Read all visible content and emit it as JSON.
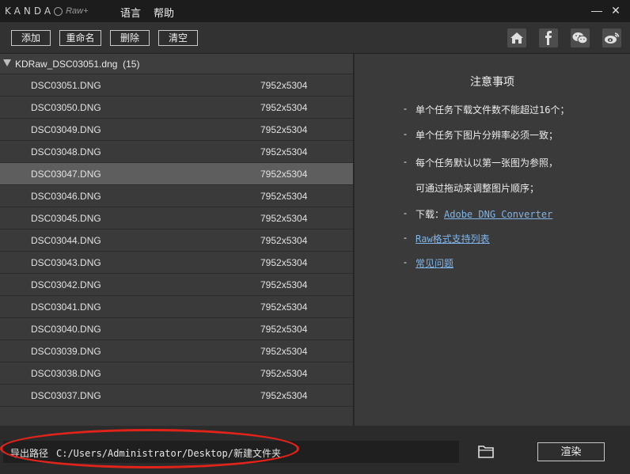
{
  "titlebar": {
    "brand": "KANDA",
    "raw": "Raw+",
    "menu_language": "语言",
    "menu_help": "帮助",
    "minimize": "—",
    "close": "✕"
  },
  "toolbar": {
    "add": "添加",
    "rename": "重命名",
    "delete": "删除",
    "clear": "清空",
    "social_icons": [
      "home-icon",
      "facebook-icon",
      "wechat-icon",
      "weibo-icon"
    ]
  },
  "filelist": {
    "group_name": "KDRaw_DSC03051.dng",
    "group_count": "(15)",
    "files": [
      {
        "name": "DSC03051.DNG",
        "res": "7952x5304"
      },
      {
        "name": "DSC03050.DNG",
        "res": "7952x5304"
      },
      {
        "name": "DSC03049.DNG",
        "res": "7952x5304"
      },
      {
        "name": "DSC03048.DNG",
        "res": "7952x5304"
      },
      {
        "name": "DSC03047.DNG",
        "res": "7952x5304"
      },
      {
        "name": "DSC03046.DNG",
        "res": "7952x5304"
      },
      {
        "name": "DSC03045.DNG",
        "res": "7952x5304"
      },
      {
        "name": "DSC03044.DNG",
        "res": "7952x5304"
      },
      {
        "name": "DSC03043.DNG",
        "res": "7952x5304"
      },
      {
        "name": "DSC03042.DNG",
        "res": "7952x5304"
      },
      {
        "name": "DSC03041.DNG",
        "res": "7952x5304"
      },
      {
        "name": "DSC03040.DNG",
        "res": "7952x5304"
      },
      {
        "name": "DSC03039.DNG",
        "res": "7952x5304"
      },
      {
        "name": "DSC03038.DNG",
        "res": "7952x5304"
      },
      {
        "name": "DSC03037.DNG",
        "res": "7952x5304"
      }
    ],
    "selected_index": 4
  },
  "notes": {
    "title": "注意事项",
    "dash": "-",
    "line1": "单个任务下载文件数不能超过16个；",
    "line2": "单个任务下图片分辨率必须一致；",
    "line3a": "每个任务默认以第一张图为参照，",
    "line3b": "可通过拖动来调整图片顺序；",
    "download_label": "下载：",
    "download_link": "Adobe DNG Converter",
    "raw_support_link": "Raw格式支持列表",
    "faq_link": "常见问题"
  },
  "bottombar": {
    "path_label": "导出路径",
    "path_value": "C:/Users/Administrator/Desktop/新建文件夹",
    "render_button": "渲染"
  },
  "colors": {
    "highlight_ellipse": "#e2231a",
    "link": "#7fb5ea",
    "selected_row": "#5e5e5e"
  }
}
